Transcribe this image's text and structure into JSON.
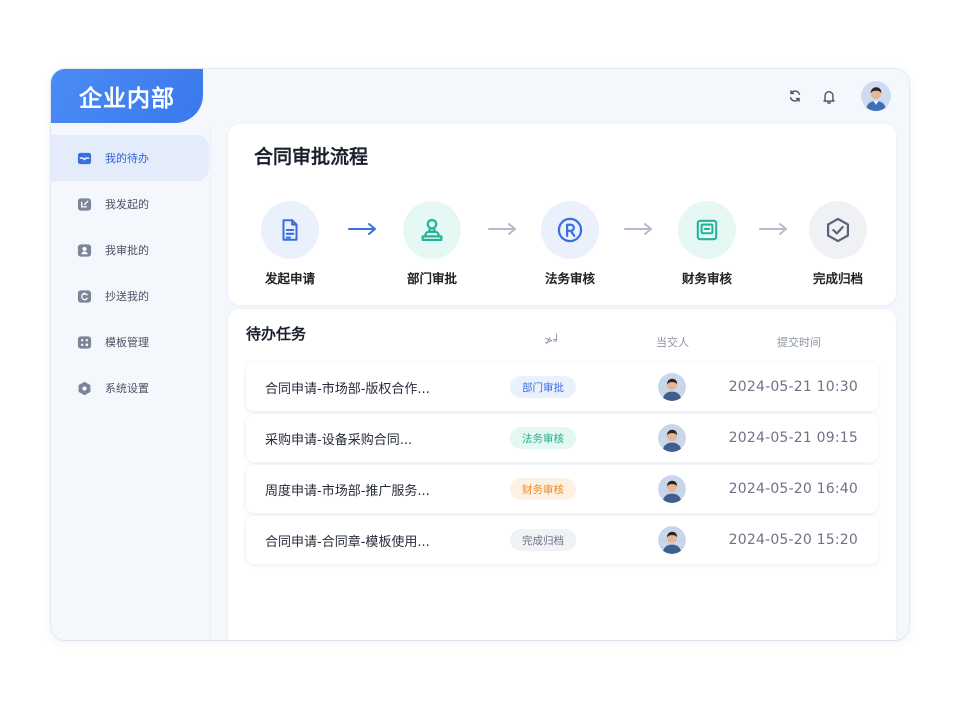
{
  "app": {
    "brand": "企业内部"
  },
  "topbar": {
    "icons": [
      "refresh-icon",
      "bell-icon"
    ],
    "avatar": "user-avatar"
  },
  "sidebar": {
    "items": [
      {
        "label": "我的待办",
        "icon": "inbox-icon",
        "active": true
      },
      {
        "label": "我发起的",
        "icon": "send-icon"
      },
      {
        "label": "我审批的",
        "icon": "user-check-icon"
      },
      {
        "label": "抄送我的",
        "icon": "cc-icon"
      },
      {
        "label": "模板管理",
        "icon": "template-icon"
      },
      {
        "label": "系统设置",
        "icon": "settings-icon"
      }
    ]
  },
  "flow": {
    "title": "合同审批流程",
    "steps": [
      {
        "label": "发起申请",
        "icon": "document-icon",
        "color": "#3b6fe0",
        "bg": "#eaf1fd"
      },
      {
        "label": "部门审批",
        "icon": "stamp-icon",
        "color": "#22b39a",
        "bg": "#e6f8f4"
      },
      {
        "label": "法务审核",
        "icon": "registered-icon",
        "color": "#3b6fe0",
        "bg": "#eaf1fd"
      },
      {
        "label": "财务审核",
        "icon": "ledger-icon",
        "color": "#22b39a",
        "bg": "#e6f8f4"
      },
      {
        "label": "完成归档",
        "icon": "shield-check-icon",
        "color": "#5a6478",
        "bg": "#eff1f5"
      }
    ]
  },
  "tasks": {
    "title": "待办任务",
    "headers": {
      "status": "≯╛",
      "submitter": "当交人",
      "time": "提交时间"
    },
    "rows": [
      {
        "name": "合同申请-市场部-版权合作...",
        "status": "部门审批",
        "status_color": "#3b6fe0",
        "status_bg": "#eaf1fd",
        "time": "2024-05-21 10:30"
      },
      {
        "name": "采购申请-设备采购合同...",
        "status": "法务审核",
        "status_color": "#1fae8c",
        "status_bg": "#e4f7f1",
        "time": "2024-05-21 09:15"
      },
      {
        "name": "周度申请-市场部-推广服务...",
        "status": "财务审核",
        "status_color": "#e88a2a",
        "status_bg": "#fdf1e3",
        "time": "2024-05-20 16:40"
      },
      {
        "name": "合同申请-合同章-模板使用...",
        "status": "完成归档",
        "status_color": "#6b7385",
        "status_bg": "#f0f2f6",
        "time": "2024-05-20 15:20"
      }
    ]
  },
  "colors": {
    "accent": "#3a78ec",
    "window_bg": "#f4f7fc"
  }
}
